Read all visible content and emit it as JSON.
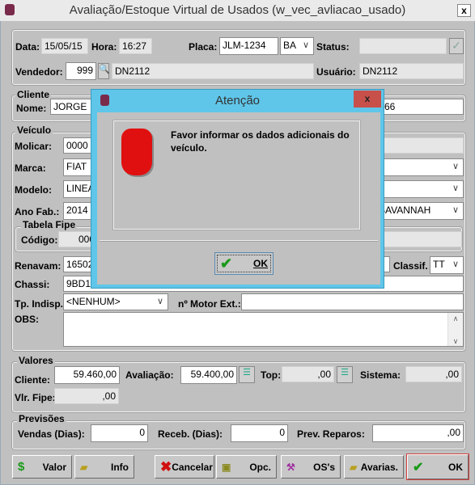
{
  "window": {
    "title": "Avaliação/Estoque Virtual de Usados (w_vec_avliacao_usado)",
    "close": "x"
  },
  "header": {
    "data_label": "Data:",
    "data": "15/05/15",
    "hora_label": "Hora:",
    "hora": "16:27",
    "placa_label": "Placa:",
    "placa": "JLM-1234",
    "uf": "BA",
    "status_label": "Status:",
    "status": "",
    "vendedor_label": "Vendedor:",
    "vendedor_code": "999",
    "vendedor_name": "DN2112",
    "usuario_label": "Usuário:",
    "usuario": "DN2112"
  },
  "cliente": {
    "title": "Cliente",
    "nome_label": "Nome:",
    "nome": "JORGE",
    "nome_tail": "66"
  },
  "veiculo": {
    "title": "Veículo",
    "molicar_label": "Molicar:",
    "molicar": "0000",
    "marca_label": "Marca:",
    "marca": "FIAT",
    "modelo_label": "Modelo:",
    "modelo": "LINEA",
    "ano_label": "Ano Fab.:",
    "ano": "2014",
    "cor": "SAVANNAH",
    "fipe_title": "Tabela Fipe",
    "codigo_label": "Código:",
    "codigo": "000",
    "renavam_label": "Renavam:",
    "renavam": "16502",
    "classif_label": "Classif.",
    "classif": "TT",
    "chassi_label": "Chassi:",
    "chassi": "9BD1",
    "tp_label": "Tp. Indisp.:",
    "tp": "<NENHUM>",
    "motor_label": "nº Motor Ext.:",
    "motor": "",
    "obs_label": "OBS:",
    "obs": ""
  },
  "valores": {
    "title": "Valores",
    "cliente_label": "Cliente:",
    "cliente": "59.460,00",
    "avaliacao_label": "Avaliação:",
    "avaliacao": "59.400,00",
    "top_label": "Top:",
    "top": ",00",
    "sistema_label": "Sistema:",
    "sistema": ",00",
    "fipe_label": "Vlr. Fipe:",
    "fipe": ",00"
  },
  "previsoes": {
    "title": "Previsões",
    "vendas_label": "Vendas (Dias):",
    "vendas": "0",
    "receb_label": "Receb. (Dias):",
    "receb": "0",
    "reparos_label": "Prev. Reparos:",
    "reparos": ",00"
  },
  "buttons": {
    "valor": "Valor",
    "info": "Info",
    "cancelar": "Cancelar",
    "opc": "Opc.",
    "oss": "OS's",
    "avarias": "Avarias.",
    "ok": "OK"
  },
  "dialog": {
    "title": "Atenção",
    "close": "x",
    "message": "Favor informar os dados adicionais do veículo.",
    "ok": "OK"
  },
  "colors": {
    "dialog_title": "#5fc6ea",
    "dialog_close": "#c7504a",
    "ok_border": "#d04040"
  }
}
